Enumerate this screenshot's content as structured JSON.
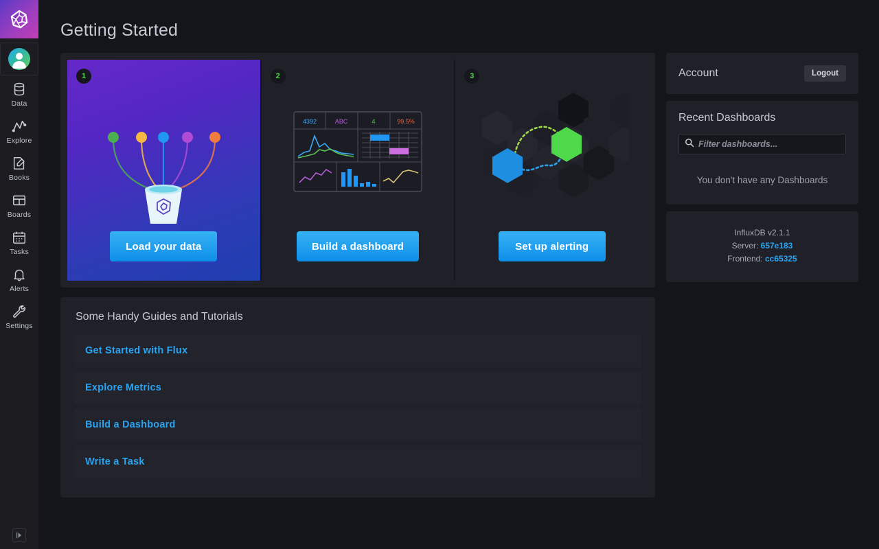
{
  "nav": {
    "logo_icon": "influxdb-logo-icon",
    "avatar_icon": "user-avatar-icon",
    "items": [
      {
        "label": "Data",
        "icon": "database-icon"
      },
      {
        "label": "Explore",
        "icon": "line-graph-icon"
      },
      {
        "label": "Books",
        "icon": "notebook-pencil-icon"
      },
      {
        "label": "Boards",
        "icon": "dashboard-grid-icon"
      },
      {
        "label": "Tasks",
        "icon": "calendar-icon"
      },
      {
        "label": "Alerts",
        "icon": "bell-icon"
      },
      {
        "label": "Settings",
        "icon": "wrench-icon"
      }
    ],
    "collapse_icon": "expand-panel-icon"
  },
  "header": {
    "title": "Getting Started"
  },
  "steps": [
    {
      "badge": "1",
      "cta_label": "Load your data",
      "art": "data-bucket-with-sources-illustration",
      "dot_colors": [
        "#4caf50",
        "#f5b942",
        "#2196f3",
        "#b04bd6",
        "#f07b3f"
      ]
    },
    {
      "badge": "2",
      "cta_label": "Build a dashboard",
      "art": "mini-dashboard-illustration",
      "stats": [
        {
          "value": "4392",
          "color": "#3aa9f5"
        },
        {
          "value": "ABC",
          "color": "#b45bd8"
        },
        {
          "value": "4",
          "color": "#5fbf5a"
        },
        {
          "value": "99.5%",
          "color": "#e0694a"
        }
      ]
    },
    {
      "badge": "3",
      "cta_label": "Set up alerting",
      "art": "hexagon-network-illustration",
      "node_colors": {
        "blue": "#1e8fe0",
        "green": "#4ed84a"
      }
    }
  ],
  "guides": {
    "title": "Some Handy Guides and Tutorials",
    "links": [
      "Get Started with Flux",
      "Explore Metrics",
      "Build a Dashboard",
      "Write a Task"
    ]
  },
  "account": {
    "title": "Account",
    "logout_label": "Logout"
  },
  "dashboards": {
    "title": "Recent Dashboards",
    "filter_placeholder": "Filter dashboards...",
    "filter_value": "",
    "search_icon": "search-icon",
    "empty_message": "You don't have any Dashboards"
  },
  "version": {
    "product": "InfluxDB v2.1.1",
    "server_label": "Server:",
    "server_hash": "657e183",
    "frontend_label": "Frontend:",
    "frontend_hash": "cc65325"
  },
  "colors": {
    "page_bg": "#14151a",
    "panel_bg": "#202128",
    "nav_bg": "#1c1c21",
    "accent_blue": "#2aa3f0",
    "accent_green": "#4ed84a"
  }
}
